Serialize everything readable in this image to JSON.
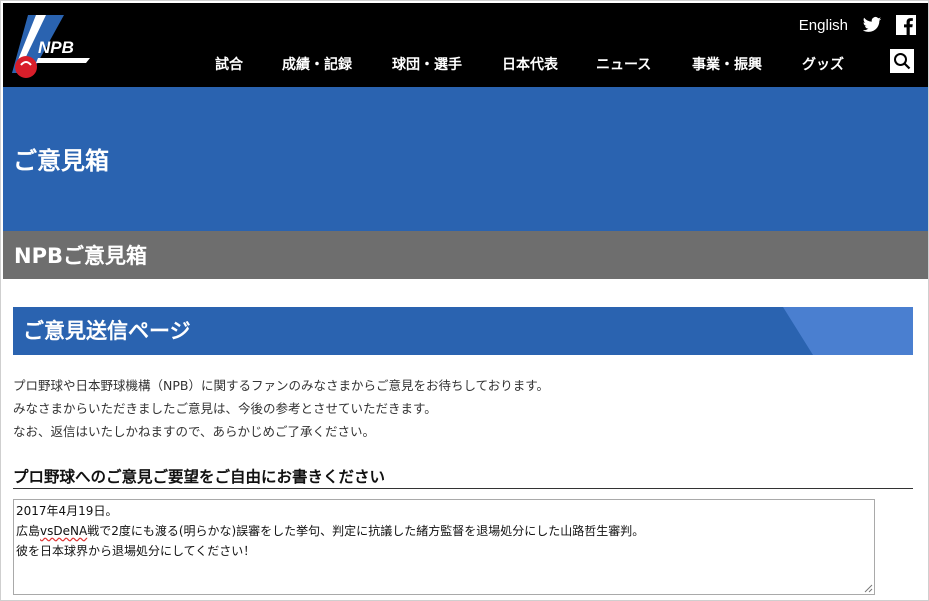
{
  "header": {
    "logo_text": "NPB",
    "english_link": "English",
    "social": [
      "twitter-icon",
      "facebook-icon"
    ],
    "nav": [
      "試合",
      "成績・記録",
      "球団・選手",
      "日本代表",
      "ニュース",
      "事業・振興",
      "グッズ"
    ],
    "search_icon": "search-icon"
  },
  "hero": {
    "title": "ご意見箱"
  },
  "subbar": {
    "title": "NPBご意見箱"
  },
  "section": {
    "title": "ご意見送信ページ"
  },
  "intro": [
    "プロ野球や日本野球機構（NPB）に関するファンのみなさまからご意見をお待ちしております。",
    "みなさまからいただきましたご意見は、今後の参考とさせていただきます。",
    "なお、返信はいたしかねますので、あらかじめご了承ください。"
  ],
  "form": {
    "heading": "プロ野球へのご意見ご要望をご自由にお書きください",
    "textarea_lines": {
      "line1": "2017年4月19日。",
      "line2_pre": "広島",
      "line2_misspelled": "vsDeNA",
      "line2_post": "戦で2度にも渡る(明らかな)誤審をした挙句、判定に抗議した緒方監督を退場処分にした山路哲生審判。",
      "line3": "彼を日本球界から退場処分にしてください！"
    }
  },
  "colors": {
    "header_bg": "#000000",
    "hero_blue": "#2a63b0",
    "subbar_gray": "#6e6e6e",
    "accent_light_blue": "#4a7fd0"
  }
}
